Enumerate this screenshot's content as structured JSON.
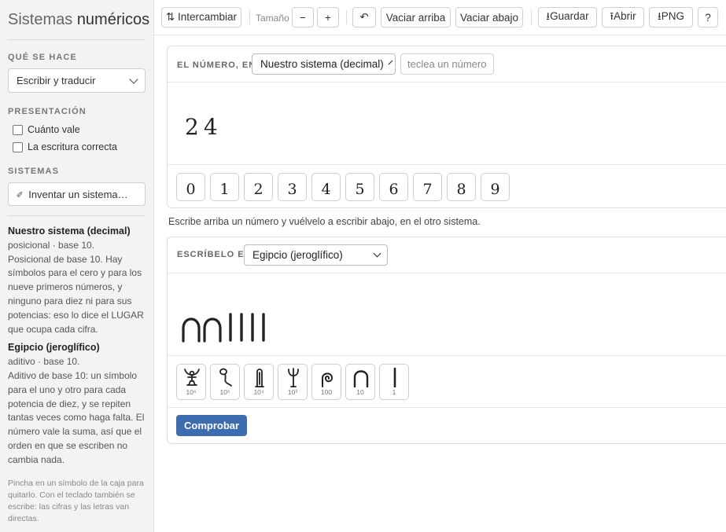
{
  "app": {
    "title_a": "Sistemas",
    "title_b": "numéricos"
  },
  "sidebar": {
    "section_mode": "QUÉ SE HACE",
    "mode_value": "Escribir y traducir",
    "section_presentation": "PRESENTACIÓN",
    "option_value": "Cuánto vale",
    "option_spelling": "La escritura correcta",
    "section_systems": "SISTEMAS",
    "invent_label": "Inventar un sistema…",
    "systems": [
      {
        "name": "Nuestro sistema (decimal)",
        "meta": "posicional · base 10.",
        "description": "Posicional de base 10. Hay símbolos para el cero y para los nueve primeros números, y ninguno para diez ni para sus potencias: eso lo dice el LUGAR que ocupa cada cifra."
      },
      {
        "name": "Egipcio (jeroglífico)",
        "meta": "aditivo · base 10.",
        "description": "Aditivo de base 10: un símbolo para el uno y otro para cada potencia de diez, y se repiten tantas veces como haga falta. El número vale la suma, así que el orden en que se escriben no cambia nada."
      },
      {}
    ],
    "hint": "Pincha en un símbolo de la caja para quitarlo. Con el teclado también se escribe: las cifras y las letras van directas."
  },
  "toolbar": {
    "swap": "⇅ Intercambiar",
    "size_label": "Tamaño",
    "minus": "−",
    "plus": "+",
    "undo": "↶",
    "clear_top": "Vaciar arriba",
    "clear_bottom": "Vaciar abajo",
    "save": "⭳Guardar",
    "open": "⭱Abrir",
    "png": "⭳PNG",
    "help": "?"
  },
  "top_panel": {
    "label": "EL NÚMERO, EN",
    "system": "Nuestro sistema (decimal)",
    "input_placeholder": "teclea un número",
    "number": "24",
    "digits": [
      "0",
      "1",
      "2",
      "3",
      "4",
      "5",
      "6",
      "7",
      "8",
      "9"
    ]
  },
  "instruction": "Escribe arriba un número y vuélvelo a escribir abajo, en el otro sistema.",
  "bottom_panel": {
    "label": "ESCRÍBELO EN",
    "system": "Egipcio (jeroglífico)",
    "written": {
      "tens": 2,
      "ones": 4
    },
    "symbols": [
      {
        "icon": "heh-god-icon",
        "value": "10⁶"
      },
      {
        "icon": "tadpole-icon",
        "value": "10⁵"
      },
      {
        "icon": "finger-icon",
        "value": "10⁴"
      },
      {
        "icon": "lotus-icon",
        "value": "10³"
      },
      {
        "icon": "coil-rope-icon",
        "value": "100"
      },
      {
        "icon": "heel-bone-icon",
        "value": "10"
      },
      {
        "icon": "stroke-icon",
        "value": "1"
      }
    ],
    "check_label": "Comprobar"
  },
  "colors": {
    "accent": "#3e6cb0",
    "sidebar_bg": "#f3f3f3"
  }
}
